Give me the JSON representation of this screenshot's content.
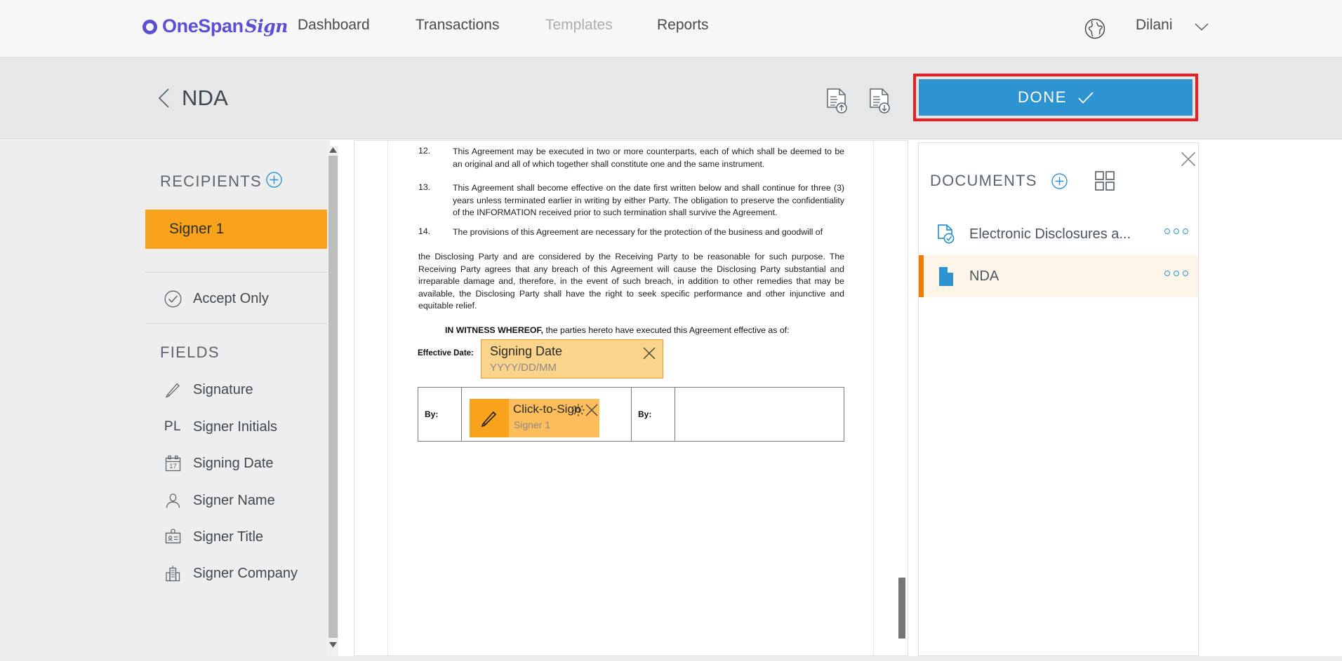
{
  "topnav": {
    "brand": {
      "word": "OneSpan",
      "script": "Sign",
      "ring_icon": "onespan-ring-icon",
      "color": "#5b4fd6"
    },
    "links": [
      {
        "label": "Dashboard",
        "active": true
      },
      {
        "label": "Transactions",
        "active": true
      },
      {
        "label": "Templates",
        "active": false
      },
      {
        "label": "Reports",
        "active": true
      }
    ],
    "globe_icon": "globe-icon",
    "user": "Dilani",
    "chevron_icon": "chevron-down-icon"
  },
  "subheader": {
    "back_icon": "chevron-left-icon",
    "title": "NDA",
    "upload_icon": "document-upload-icon",
    "download_icon": "document-download-icon",
    "done_label": "DONE",
    "done_check_icon": "checkmark-icon",
    "highlight_color": "#ef1c24",
    "done_color": "#2e93d1"
  },
  "sidebar": {
    "recipients_label": "RECIPIENTS",
    "add_recipient_icon": "plus-circle-icon",
    "recipients": [
      {
        "name": "Signer 1",
        "selected": true,
        "color": "#f9a21b"
      }
    ],
    "accept_only": {
      "label": "Accept Only",
      "icon": "check-circle-icon"
    },
    "fields_label": "FIELDS",
    "fields": [
      {
        "label": "Signature",
        "icon": "pencil-icon"
      },
      {
        "label": "Signer Initials",
        "icon": "pl-text-icon",
        "glyph": "PL"
      },
      {
        "label": "Signing Date",
        "icon": "calendar-icon",
        "glyph": "17"
      },
      {
        "label": "Signer Name",
        "icon": "person-icon"
      },
      {
        "label": "Signer Title",
        "icon": "id-badge-icon"
      },
      {
        "label": "Signer Company",
        "icon": "building-icon"
      }
    ],
    "scroll_up_icon": "scroll-up-arrow-icon",
    "scroll_down_icon": "scroll-down-arrow-icon"
  },
  "document": {
    "paragraphs": [
      {
        "number": "12.",
        "text": "This Agreement may be executed in two or more counterparts, each of which shall be deemed to be an original and all of which together shall constitute one and the same instrument."
      },
      {
        "number": "13.",
        "text": "This Agreement shall become effective on the date first written below and shall continue for three (3) years unless terminated earlier in writing by either Party. The obligation to preserve the confidentiality of the INFORMATION received prior to such termination shall survive the Agreement."
      },
      {
        "number": "14.",
        "text": "The provisions of this Agreement are necessary for the protection of the business and goodwill of",
        "text2": "the Disclosing Party and are considered by the Receiving Party to be reasonable for such purpose. The Receiving Party agrees that any breach of this Agreement will cause the Disclosing Party substantial and irreparable damage and, therefore, in the event of such breach, in addition to other remedies that may be available, the Disclosing Party shall have the right to seek specific performance and other injunctive and equitable relief."
      }
    ],
    "witness_bold": "IN WITNESS WHEREOF,",
    "witness_rest": " the parties hereto have executed this Agreement effective as of:",
    "effective_date_label": "Effective Date:",
    "date_field": {
      "title": "Signing Date",
      "format": "YYYY/DD/MM",
      "close_icon": "close-x-icon",
      "fill": "#fbd48b",
      "border": "#e89a2b"
    },
    "signature_table": {
      "by_label_left": "By:",
      "by_label_right": "By:"
    },
    "sign_field": {
      "title": "Click-to-Sign",
      "assignee": "Signer 1",
      "pen_icon": "pencil-icon",
      "gear_icon": "gear-icon",
      "close_icon": "close-x-icon",
      "fill": "#fcbd5a",
      "accent": "#f9a21b"
    }
  },
  "documents_panel": {
    "title": "DOCUMENTS",
    "add_icon": "plus-circle-icon",
    "grid_icon": "grid-view-icon",
    "close_icon": "close-x-icon",
    "items": [
      {
        "name": "Electronic Disclosures a...",
        "icon": "document-check-icon",
        "selected": false
      },
      {
        "name": "NDA",
        "icon": "document-filled-icon",
        "selected": true
      }
    ],
    "menu_icon": "more-options-icon",
    "selected_accent": "#f07c00"
  }
}
